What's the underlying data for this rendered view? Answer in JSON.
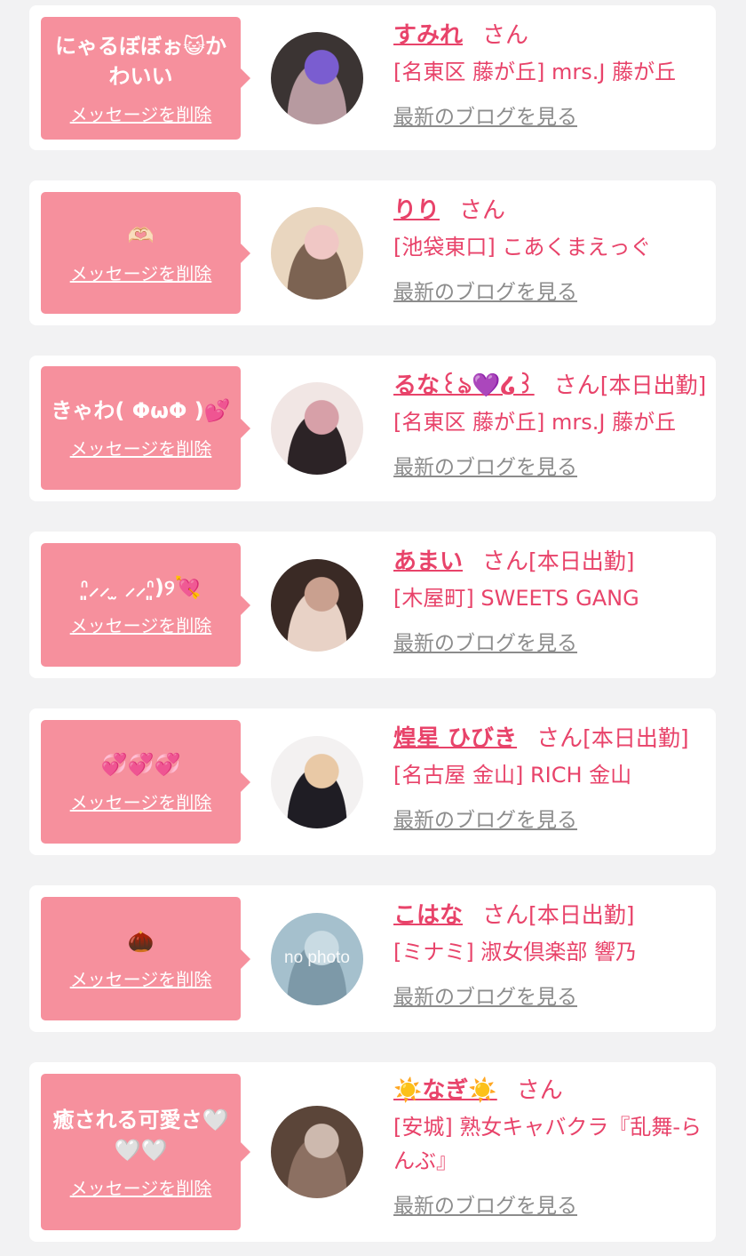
{
  "entries": [
    {
      "message": "にゃるぼぼぉ😺かわいい",
      "delete_label": "メッセージを削除",
      "name": "すみれ",
      "honorific": "さん",
      "status": "",
      "shop": "[名東区 藤が丘] mrs.J 藤が丘",
      "blog_link": "最新のブログを見る",
      "avatar_colors": [
        "#3b3433",
        "#b79aa0",
        "#7a5dd0"
      ]
    },
    {
      "message": "🫶🏻",
      "delete_label": "メッセージを削除",
      "name": "りり",
      "honorific": "さん",
      "status": "",
      "shop": "[池袋東口] こあくまえっぐ",
      "blog_link": "最新のブログを見る",
      "avatar_colors": [
        "#e9d6bf",
        "#7c6352",
        "#f0c7c5"
      ]
    },
    {
      "message": "きゃわ( ΦωΦ )💕",
      "delete_label": "メッセージを削除",
      "name": "るな꒰ঌ💜໒꒱",
      "honorific": "さん",
      "status": "[本日出勤]",
      "shop": "[名東区 藤が丘] mrs.J 藤が丘",
      "blog_link": "最新のブログを見る",
      "avatar_colors": [
        "#f1e6e4",
        "#2c2326",
        "#d7a0a8"
      ]
    },
    {
      "message": "ᐢ͈⸝⸝ ̫ ⸝⸝ᐢ͈)୨💘",
      "delete_label": "メッセージを削除",
      "name": "あまい",
      "honorific": "さん",
      "status": "[本日出勤]",
      "shop": "[木屋町] SWEETS GANG",
      "blog_link": "最新のブログを見る",
      "avatar_colors": [
        "#3a2a25",
        "#e8d2c6",
        "#c9a08f"
      ]
    },
    {
      "message": "💞💞💞",
      "delete_label": "メッセージを削除",
      "name": "煌星 ひびき",
      "honorific": "さん",
      "status": "[本日出勤]",
      "shop": "[名古屋 金山] RICH 金山",
      "blog_link": "最新のブログを見る",
      "avatar_colors": [
        "#f3f1f1",
        "#1f1d24",
        "#e9c9a6"
      ]
    },
    {
      "message": "🌰",
      "delete_label": "メッセージを削除",
      "name": "こはな",
      "honorific": "さん",
      "status": "[本日出勤]",
      "shop": "[ミナミ] 淑女倶楽部 響乃",
      "blog_link": "最新のブログを見る",
      "avatar_colors": [
        "#a5c0cd",
        "#7d99a8",
        "#c9dbe3"
      ],
      "avatar_text": "no photo"
    },
    {
      "message": "癒される可愛さ🤍🤍🤍",
      "delete_label": "メッセージを削除",
      "name": "☀️なぎ☀️",
      "honorific": "さん",
      "status": "",
      "shop": "[安城] 熟女キャバクラ『乱舞-らんぶ』",
      "blog_link": "最新のブログを見る",
      "avatar_colors": [
        "#5b4539",
        "#8c7062",
        "#cdb9ae"
      ]
    }
  ]
}
